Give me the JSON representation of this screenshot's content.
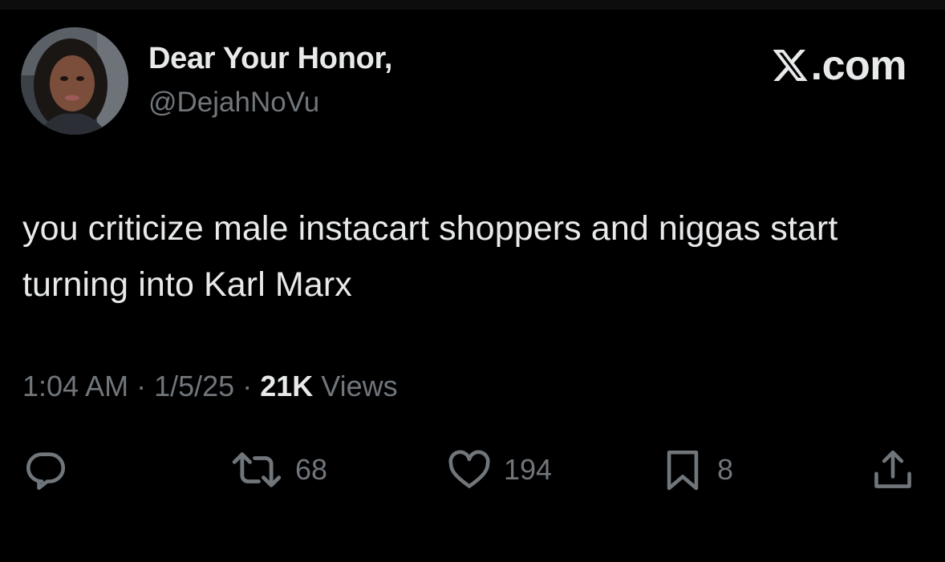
{
  "author": {
    "display_name": "Dear Your Honor,",
    "handle": "@DejahNoVu"
  },
  "brand": {
    "logo_icon": "x-logo-icon",
    "text": ".com"
  },
  "tweet": {
    "text": "you criticize male instacart shoppers and niggas start turning into Karl Marx"
  },
  "meta": {
    "time": "1:04 AM",
    "separator": " · ",
    "date": "1/5/25",
    "views_count": "21K",
    "views_label": "Views"
  },
  "actions": {
    "reply": {
      "icon": "reply-icon"
    },
    "repost": {
      "icon": "repost-icon",
      "count": "68"
    },
    "like": {
      "icon": "heart-icon",
      "count": "194"
    },
    "bookmark": {
      "icon": "bookmark-icon",
      "count": "8"
    },
    "share": {
      "icon": "share-icon"
    }
  },
  "colors": {
    "background": "#000000",
    "primary_text": "#e7e9ea",
    "secondary_text": "#71767b"
  }
}
